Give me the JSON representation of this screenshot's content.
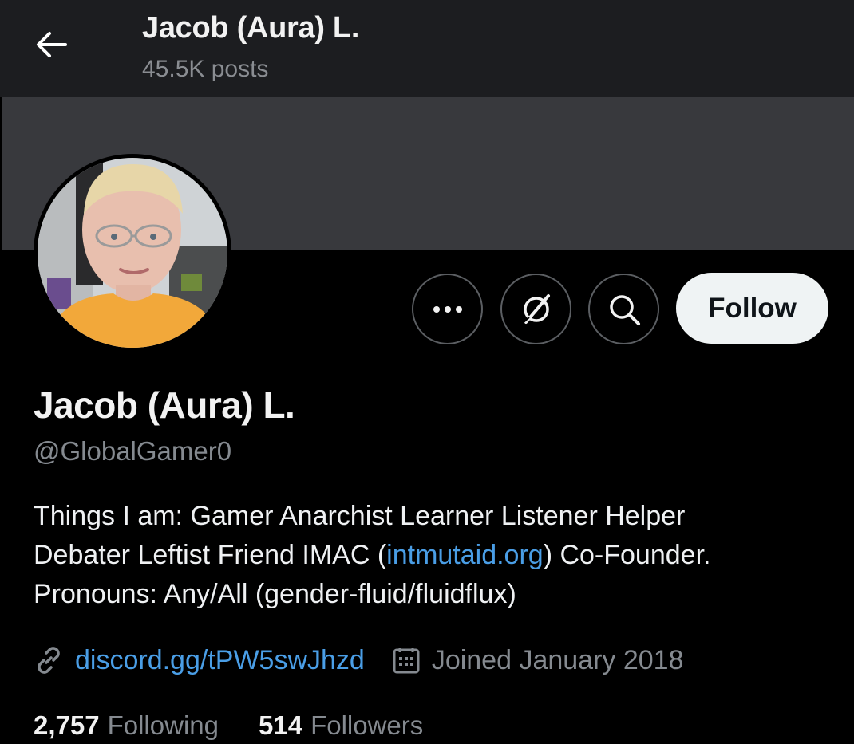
{
  "header": {
    "title": "Jacob (Aura) L.",
    "post_count": "45.5K posts"
  },
  "actions": {
    "more_icon": "ellipsis-icon",
    "grok_icon": "grok-icon",
    "search_icon": "search-icon",
    "follow_label": "Follow"
  },
  "profile": {
    "display_name": "Jacob (Aura) L.",
    "handle": "@GlobalGamer0",
    "bio": {
      "line1": "Things I am: Gamer  Anarchist  Learner  Listener  Helper",
      "line2_before": "Debater  Leftist  Friend  IMAC (",
      "line2_link": "intmutaid.org",
      "line2_after": ") Co-Founder.",
      "line3": "Pronouns: Any/All (gender-fluid/fluidflux)"
    },
    "website": "discord.gg/tPW5swJhzd",
    "joined": "Joined January 2018",
    "following_count": "2,757",
    "following_label": "Following",
    "followers_count": "514",
    "followers_label": "Followers"
  },
  "colors": {
    "background": "#000000",
    "header_bg": "#1c1d20",
    "banner": "#38393d",
    "link": "#4a9ee6",
    "secondary_text": "#858a90",
    "follow_button_bg": "#eff3f4"
  }
}
